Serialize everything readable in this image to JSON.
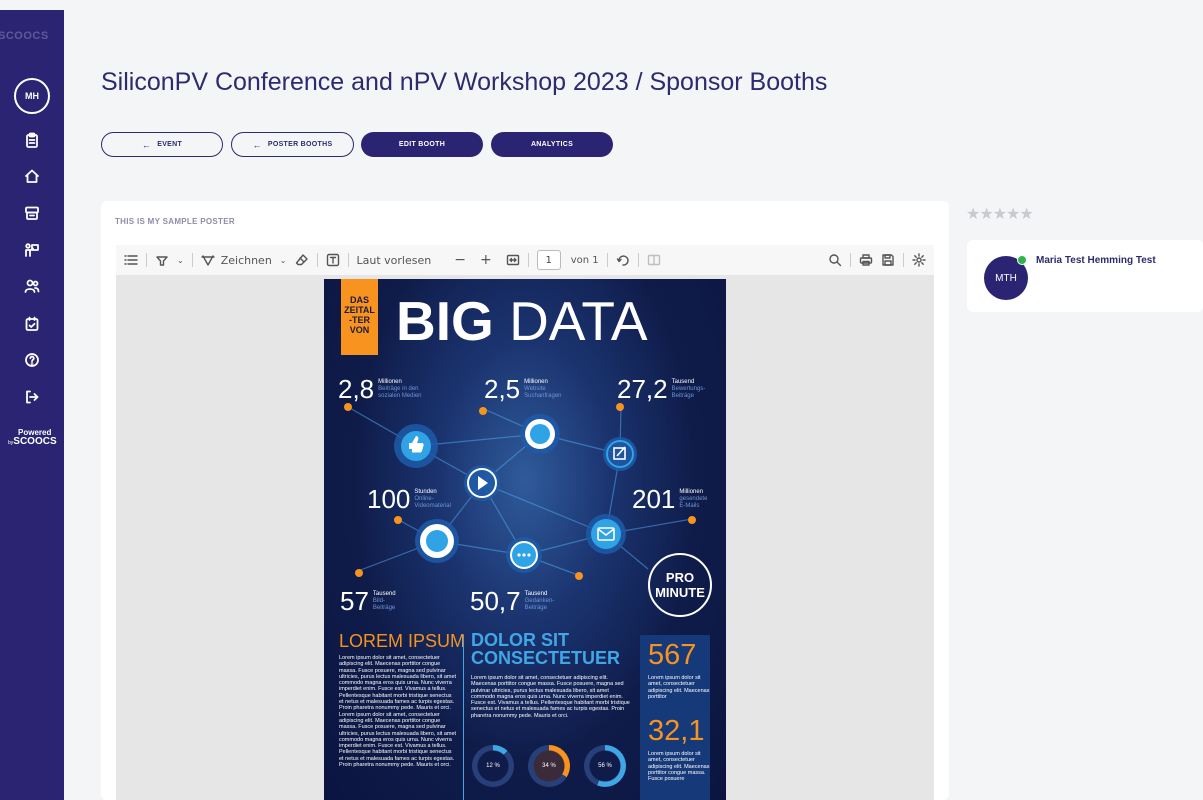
{
  "sidebar": {
    "brand": "SCOOCS",
    "avatar_initials": "MH",
    "powered_label": "Powered",
    "powered_by": "by",
    "powered_brand": "SCOOCS"
  },
  "header": {
    "title": "SiliconPV Conference and nPV Workshop 2023 / Sponsor Booths"
  },
  "actions": {
    "event": "EVENT",
    "poster_booths": "POSTER BOOTHS",
    "edit_booth": "EDIT BOOTH",
    "analytics": "ANALYTICS"
  },
  "poster_card": {
    "label": "THIS IS MY SAMPLE POSTER",
    "toolbar": {
      "draw_label": "Zeichnen",
      "read_aloud_label": "Laut vorlesen",
      "page_value": "1",
      "page_of": "von 1"
    }
  },
  "poster": {
    "tag_lines": [
      "DAS",
      "ZEITAL",
      "-TER",
      "VON"
    ],
    "title_bold": "BIG",
    "title_light": "DATA",
    "stats": [
      {
        "value": "2,8",
        "unit": "Millionen",
        "desc": [
          "Beiträge in den",
          "sozialen Medien"
        ]
      },
      {
        "value": "2,5",
        "unit": "Millionen",
        "desc": [
          "Website",
          "Suchanfragen"
        ]
      },
      {
        "value": "27,2",
        "unit": "Tausend",
        "desc": [
          "Bewertungs-",
          "Beiträge"
        ]
      },
      {
        "value": "100",
        "unit": "Stunden",
        "desc": [
          "Online-",
          "Videomaterial"
        ]
      },
      {
        "value": "201",
        "unit": "Millionen",
        "desc": [
          "gesendete",
          "E-Mails"
        ]
      },
      {
        "value": "57",
        "unit": "Tausend",
        "desc": [
          "Bild-",
          "Beiträge"
        ]
      },
      {
        "value": "50,7",
        "unit": "Tausend",
        "desc": [
          "Gedanken-",
          "Beiträge"
        ]
      }
    ],
    "pro_minute": [
      "PRO",
      "MINUTE"
    ],
    "lorem_title": "LOREM IPSUM",
    "lorem_text": "Lorem ipsum dolor sit amet, consectetuer adipiscing elit. Maecenas porttitor congue massa. Fusce posuere, magna sed pulvinar ultricies, purus lectus malesuada libero, sit amet commodo magna eros quis urna. Nunc viverra imperdiet enim. Fusce est. Vivamus a tellus. Pellentesque habitant morbi tristique senectus et netus et malesuada fames ac turpis egestas. Proin pharetra nonummy pede. Mauris et orci. Lorem ipsum dolor sit amet, consectetuer adipiscing elit. Maecenas porttitor congue massa. Fusce posuere, magna sed pulvinar ultricies, purus lectus malesuada libero, sit amet commodo magna eros quis urna. Nunc viverra imperdiet enim. Fusce est. Vivamus a tellus. Pellentesque habitant morbi tristique senectus et netus et malesuada fames ac turpis egestas. Proin pharetra nonummy pede. Mauris et orci.",
    "dolor_title": [
      "DOLOR SIT",
      "CONSECTETUER"
    ],
    "dolor_text": "Lorem ipsum dolor sit amet, consectetuer adipiscing elit. Maecenas porttitor congue massa. Fusce posuere, magna sed pulvinar ultricies, purus lectus malesuada libero, sit amet commodo magna eros quis urna. Nunc viverra imperdiet enim. Fusce est. Vivamus a tellus. Pellentesque habitant morbi tristique senectus et netus et malesuada fames ac turpis egestas. Proin pharetra nonummy pede. Mauris et orci.",
    "rings": [
      {
        "label": "12 %",
        "fraction": 0.12
      },
      {
        "label": "34 %",
        "fraction": 0.34
      },
      {
        "label": "56 %",
        "fraction": 0.56
      }
    ],
    "side_stat_1": "567",
    "side_text_1": "Lorem ipsum dolor sit amet, consectetuer adipiscing elit. Maecenas porttitor",
    "side_stat_2": "32,1",
    "side_text_2": "Lorem ipsum dolor sit amet, consectetuer adipiscing elit. Maecenas porttitor congue massa. Fusce posuere"
  },
  "rating": {
    "stars": "★★★★★",
    "value": 0,
    "max": 5
  },
  "member": {
    "initials": "MTH",
    "name": "Maria Test Hemming Test",
    "online": true
  },
  "colors": {
    "sidebar": "#2a2472",
    "primary": "#2d2a6e",
    "poster_orange": "#f7931e",
    "poster_blue": "#41a6e6",
    "online": "#2fb34a"
  }
}
